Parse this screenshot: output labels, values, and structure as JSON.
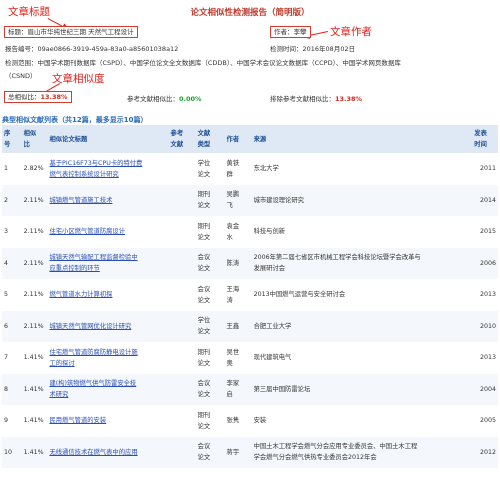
{
  "report_title": "论文相似性检测报告（简明版）",
  "annotations": {
    "title_label": "文章标题",
    "author_label": "文章作者",
    "similarity_label": "文章相似度"
  },
  "header": {
    "title_field": "标题：眉山市华纯世纪三期 天然气工程设计",
    "author_field": "作者：李攀",
    "report_number": "报告编号：09ae0866-3919-459a-83a0-a85601038a12",
    "check_time": "检测时间：2016年08月02日",
    "scope_line1": "检测范围：中国学术期刊数据库（CSPD）、中国学位论文全文数据库（CDDB）、中国学术会议论文数据库（CCPD）、中国学术网页数据库",
    "scope_line2": "（CSND）"
  },
  "metrics": {
    "total_label": "总相似比：",
    "total_value": "13.38%",
    "ref_label": "参考文献相似比：",
    "ref_value": "0.00%",
    "excl_label": "排除参考文献相似比：",
    "excl_value": "13.38%"
  },
  "list_title": "典型相似文献列表（共12篇，最多显示10篇）",
  "table": {
    "headers": {
      "no": [
        "序",
        "号"
      ],
      "sim": [
        "相似",
        "比"
      ],
      "title": "相似论文标题",
      "ref": [
        "参考",
        "文献"
      ],
      "type": [
        "文献",
        "类型"
      ],
      "author": "作者",
      "source": "来源",
      "year": [
        "发表",
        "时间"
      ]
    },
    "rows": [
      {
        "no": "1",
        "sim": "2.82%",
        "title": [
          "基于PIC16F73与CPU卡的特付费",
          "燃气表控制系统设计研究"
        ],
        "ref": "",
        "type": [
          "学位",
          "论文"
        ],
        "author": [
          "黄铁",
          "群"
        ],
        "source": [
          "东北大学"
        ],
        "year": "2011"
      },
      {
        "no": "2",
        "sim": "2.11%",
        "title": [
          "城镇燃气管道施工技术"
        ],
        "ref": "",
        "type": [
          "期刊",
          "论文"
        ],
        "author": [
          "吴鹏",
          "飞"
        ],
        "source": [
          "城市建设理论研究"
        ],
        "year": "2014"
      },
      {
        "no": "3",
        "sim": "2.11%",
        "title": [
          "住宅小区燃气管道防腐设计"
        ],
        "ref": "",
        "type": [
          "期刊",
          "论文"
        ],
        "author": [
          "袁金",
          "水"
        ],
        "source": [
          "科技与创新"
        ],
        "year": "2015"
      },
      {
        "no": "4",
        "sim": "2.11%",
        "title": [
          "城镇天然气输配工程监督检验中",
          "应重点控制的环节"
        ],
        "ref": "",
        "type": [
          "会议",
          "论文"
        ],
        "author": [
          "陈涛"
        ],
        "source": [
          "2006年第二届七省区市机械工程学会科技论坛暨学会改革与",
          "发展研讨会"
        ],
        "year": "2006"
      },
      {
        "no": "5",
        "sim": "2.11%",
        "title": [
          "燃气管道水力计算初探"
        ],
        "ref": "",
        "type": [
          "会议",
          "论文"
        ],
        "author": [
          "王海",
          "涛"
        ],
        "source": [
          "2013中国燃气运营与安全研讨会"
        ],
        "year": "2013"
      },
      {
        "no": "6",
        "sim": "2.11%",
        "title": [
          "城镇天然气管网优化设计研究"
        ],
        "ref": "",
        "type": [
          "学位",
          "论文"
        ],
        "author": [
          "王鑫"
        ],
        "source": [
          "合肥工业大学"
        ],
        "year": "2010"
      },
      {
        "no": "7",
        "sim": "1.41%",
        "title": [
          "住宅燃气管道防腐防静电设计施",
          "工的探讨"
        ],
        "ref": "",
        "type": [
          "期刊",
          "论文"
        ],
        "author": [
          "吴世",
          "奥"
        ],
        "source": [
          "现代建筑电气"
        ],
        "year": "2013"
      },
      {
        "no": "8",
        "sim": "1.41%",
        "title": [
          "建(构)筑物燃气供气防雷安全技",
          "术研究"
        ],
        "ref": "",
        "type": [
          "会议",
          "论文"
        ],
        "author": [
          "李家",
          "启"
        ],
        "source": [
          "第三届中国防雷论坛"
        ],
        "year": "2004"
      },
      {
        "no": "9",
        "sim": "1.41%",
        "title": [
          "民用燃气管道的安装"
        ],
        "ref": "",
        "type": [
          "期刊",
          "论文"
        ],
        "author": [
          "张隽"
        ],
        "source": [
          "安装"
        ],
        "year": "2005"
      },
      {
        "no": "10",
        "sim": "1.41%",
        "title": [
          "无线通信技术在燃气表中的应用"
        ],
        "ref": "",
        "type": [
          "会议",
          "论文"
        ],
        "author": [
          "蒋宇"
        ],
        "source": [
          "中国土木工程学会燃气分会应用专业委员会、中国土木工程",
          "学会燃气分会燃气供热专业委员会2012年会"
        ],
        "year": "2012"
      }
    ]
  }
}
